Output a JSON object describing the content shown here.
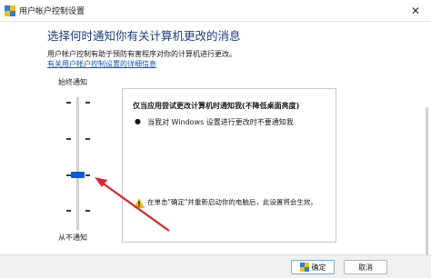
{
  "window": {
    "title": "用户帐户控制设置",
    "close_glyph": "✕"
  },
  "main": {
    "heading": "选择何时通知你有关计算机更改的消息",
    "description": "用户帐户控制有助于预防有害程序对你的计算机进行更改。",
    "link": "有关用户帐户控制设置的详细信息"
  },
  "slider": {
    "top_label": "始终通知",
    "bottom_label": "从不通知",
    "levels": 4,
    "selected_level": 2,
    "thumb_color": "#0a5bd6"
  },
  "info_panel": {
    "title": "仅当应用尝试更改计算机时通知我(不降低桌面亮度)",
    "bullet": "当我对 Windows 设置进行更改时不要通知我",
    "warning": "在单击\"确定\"并重新启动你的电脑后，此设置将会生效。"
  },
  "annotation": {
    "arrow_color": "#e0242a"
  },
  "footer": {
    "ok_label": "确定",
    "cancel_label": "取消"
  },
  "icons": {
    "app": "uac-shield-icon",
    "warning": "warning-icon",
    "ok_shield": "uac-shield-icon"
  }
}
